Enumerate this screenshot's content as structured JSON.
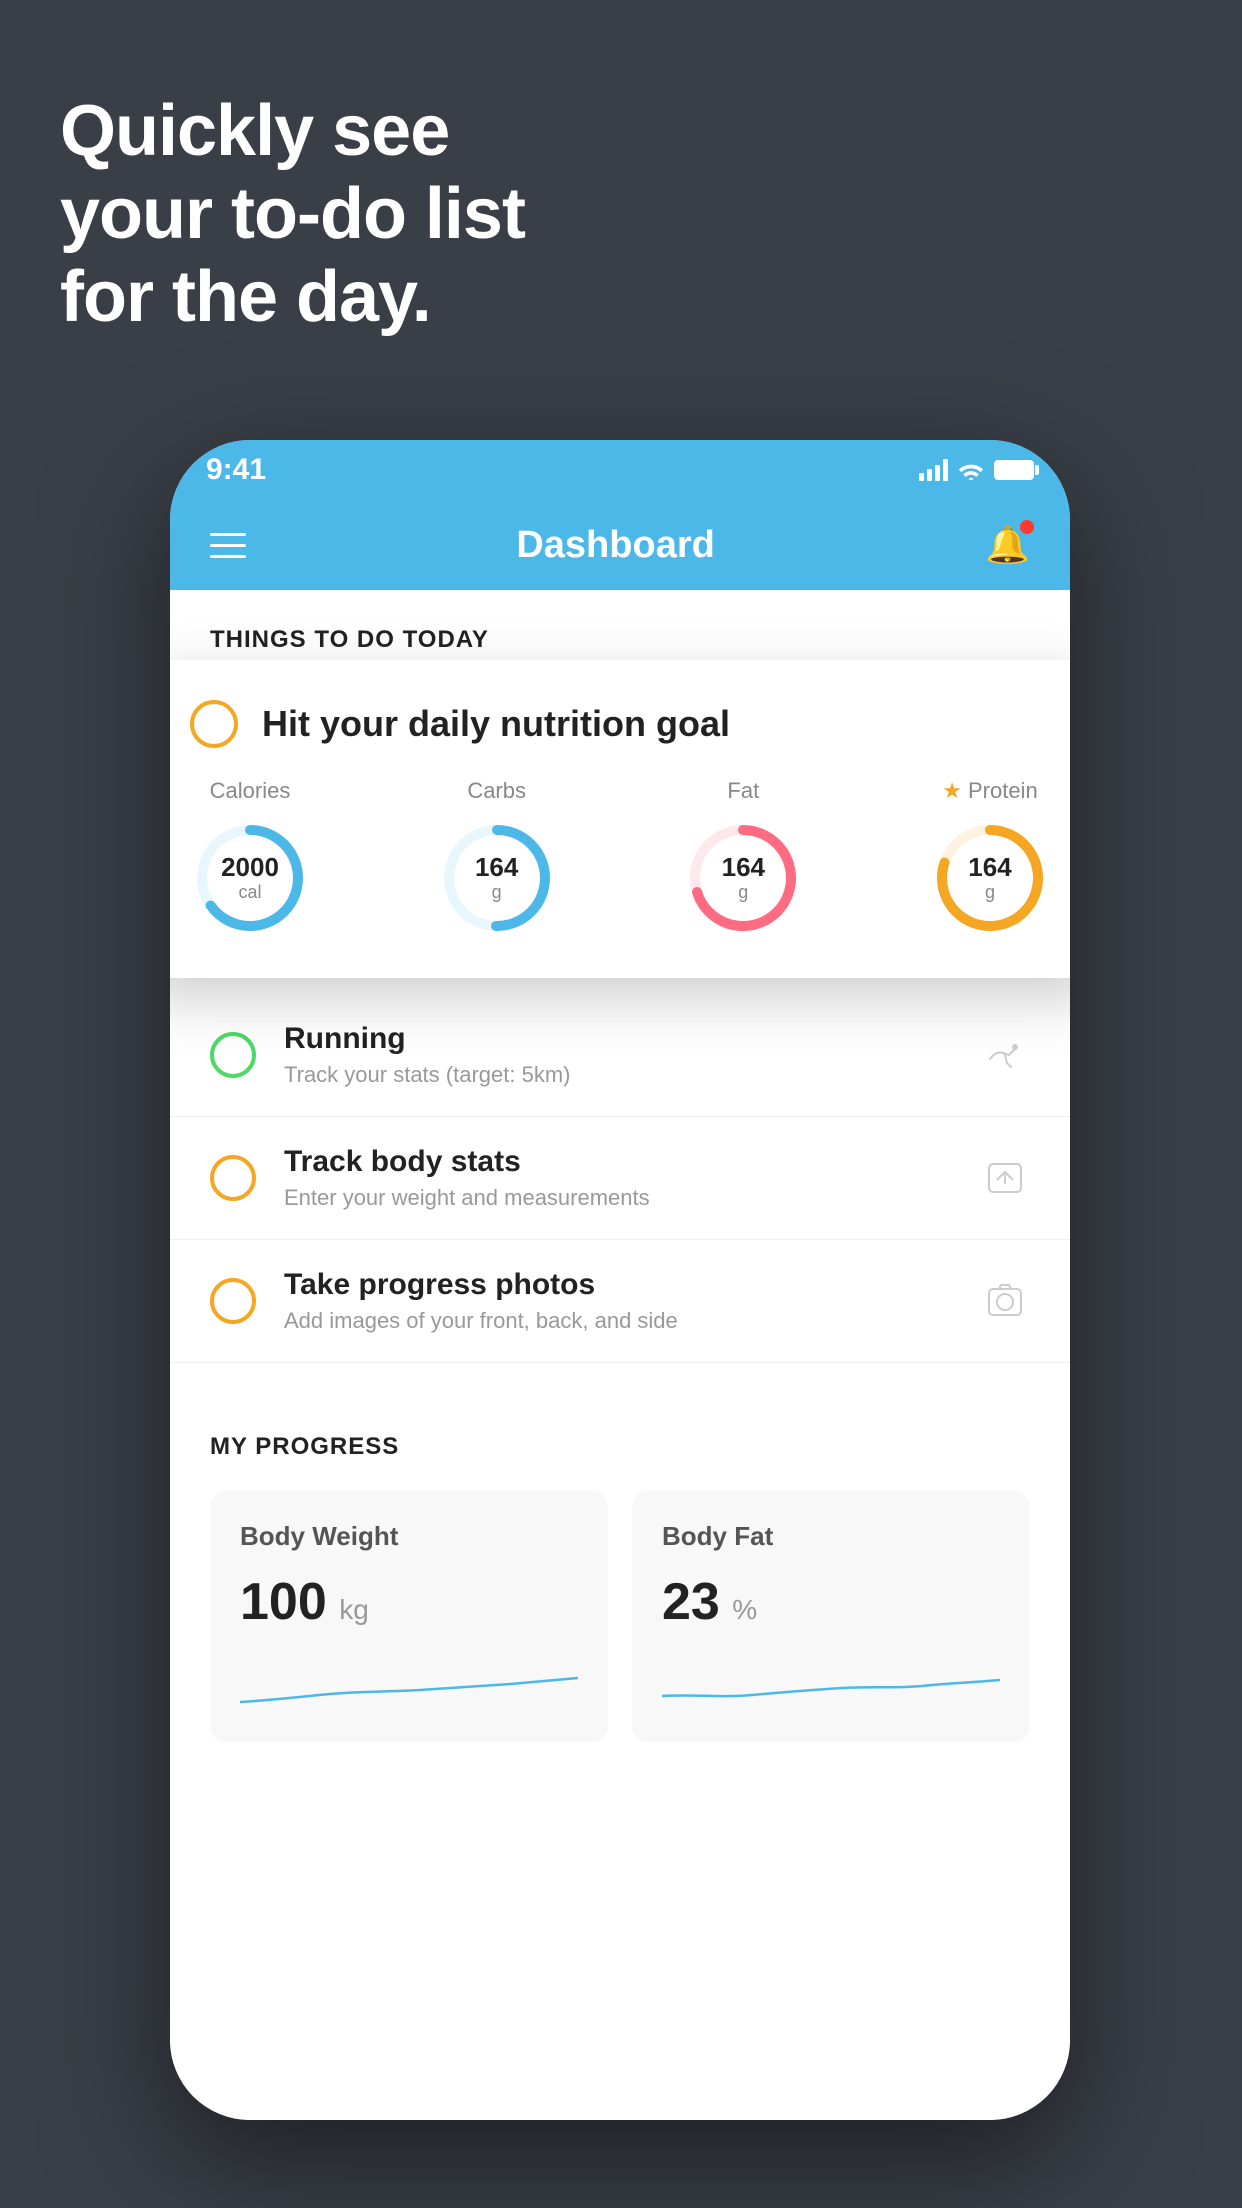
{
  "headline": {
    "line1": "Quickly see",
    "line2": "your to-do list",
    "line3": "for the day."
  },
  "status_bar": {
    "time": "9:41"
  },
  "nav": {
    "title": "Dashboard"
  },
  "section_header": "THINGS TO DO TODAY",
  "floating_card": {
    "title": "Hit your daily nutrition goal",
    "nutrition": [
      {
        "label": "Calories",
        "value": "2000",
        "unit": "cal",
        "color": "#4cb8e8",
        "track_pct": 65,
        "has_star": false
      },
      {
        "label": "Carbs",
        "value": "164",
        "unit": "g",
        "color": "#4cb8e8",
        "track_pct": 50,
        "has_star": false
      },
      {
        "label": "Fat",
        "value": "164",
        "unit": "g",
        "color": "#ff6b81",
        "track_pct": 70,
        "has_star": false
      },
      {
        "label": "Protein",
        "value": "164",
        "unit": "g",
        "color": "#f5a623",
        "track_pct": 80,
        "has_star": true
      }
    ]
  },
  "list_items": [
    {
      "title": "Running",
      "subtitle": "Track your stats (target: 5km)",
      "circle_color": "green",
      "icon": "shoe"
    },
    {
      "title": "Track body stats",
      "subtitle": "Enter your weight and measurements",
      "circle_color": "yellow",
      "icon": "scale"
    },
    {
      "title": "Take progress photos",
      "subtitle": "Add images of your front, back, and side",
      "circle_color": "yellow",
      "icon": "photo"
    }
  ],
  "progress": {
    "section_title": "MY PROGRESS",
    "cards": [
      {
        "title": "Body Weight",
        "value": "100",
        "unit": "kg"
      },
      {
        "title": "Body Fat",
        "value": "23",
        "unit": "%"
      }
    ]
  }
}
